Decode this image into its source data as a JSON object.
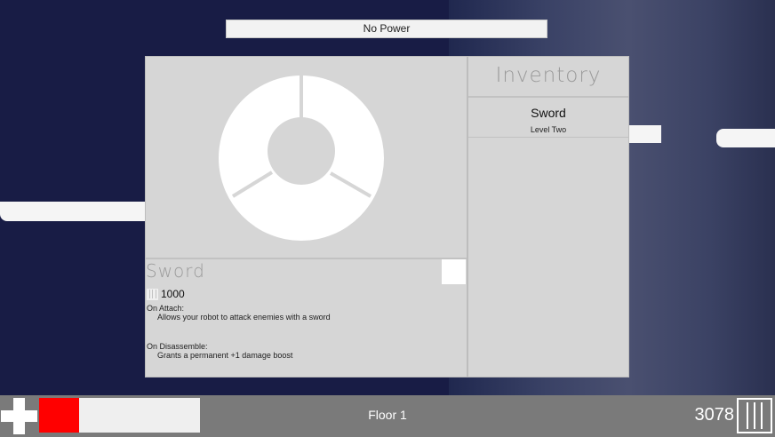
{
  "power": {
    "label": "No Power"
  },
  "selected_item": {
    "title": "Sword",
    "cost": "1000",
    "on_attach_label": "On Attach:",
    "on_attach_text": "Allows your robot to attack enemies with a sword",
    "on_disassemble_label": "On Disassemble:",
    "on_disassemble_text": "Grants a permanent +1 damage boost"
  },
  "inventory": {
    "title": "Inventory",
    "items": [
      {
        "name": "Sword",
        "level": "Level Two"
      }
    ]
  },
  "hud": {
    "floor": "Floor 1",
    "currency": "3078",
    "health_fraction": 0.25,
    "health_color": "#ff0000"
  },
  "icons": {
    "preview": "radial-ring-icon",
    "health": "plus-cross-icon",
    "cost": "currency-bars-icon",
    "currency": "currency-bars-icon"
  },
  "colors": {
    "panel": "#d6d6d6",
    "hud": "#7a7a7a",
    "background": "#181c45"
  }
}
